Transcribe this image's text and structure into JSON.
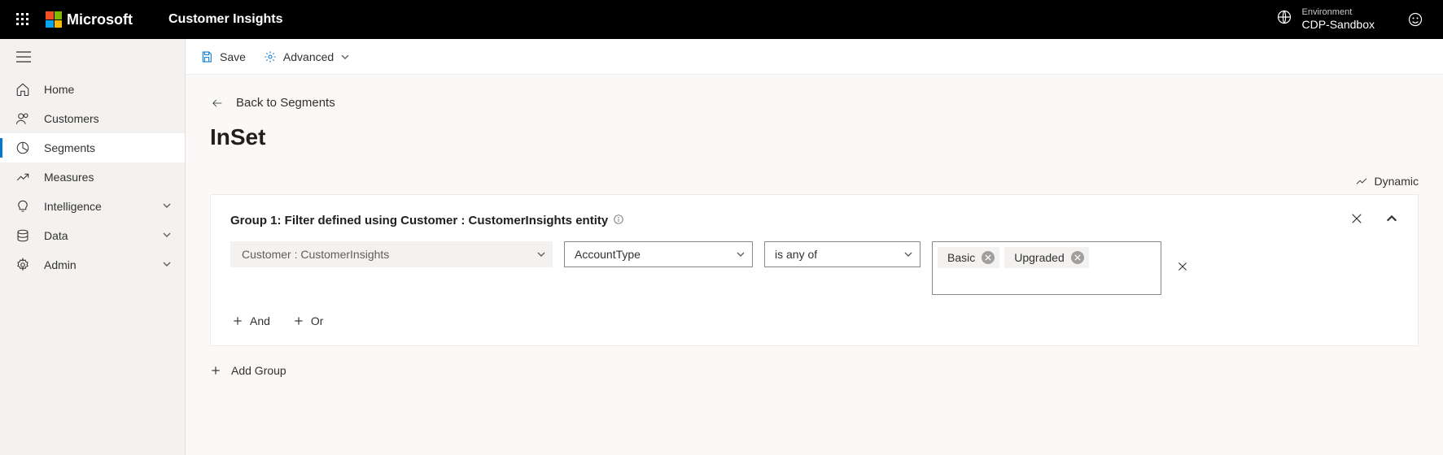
{
  "header": {
    "brand": "Microsoft",
    "app": "Customer Insights",
    "env_label": "Environment",
    "env_name": "CDP-Sandbox"
  },
  "nav": {
    "items": [
      {
        "label": "Home"
      },
      {
        "label": "Customers"
      },
      {
        "label": "Segments"
      },
      {
        "label": "Measures"
      },
      {
        "label": "Intelligence"
      },
      {
        "label": "Data"
      },
      {
        "label": "Admin"
      }
    ]
  },
  "cmd": {
    "save": "Save",
    "advanced": "Advanced"
  },
  "page": {
    "back": "Back to Segments",
    "title": "InSet",
    "dynamic": "Dynamic",
    "add_group": "Add Group"
  },
  "group": {
    "header": "Group 1: Filter defined using Customer : CustomerInsights entity",
    "entity": "Customer : CustomerInsights",
    "attribute": "AccountType",
    "operator": "is any of",
    "values": [
      "Basic",
      "Upgraded"
    ],
    "and": "And",
    "or": "Or"
  }
}
